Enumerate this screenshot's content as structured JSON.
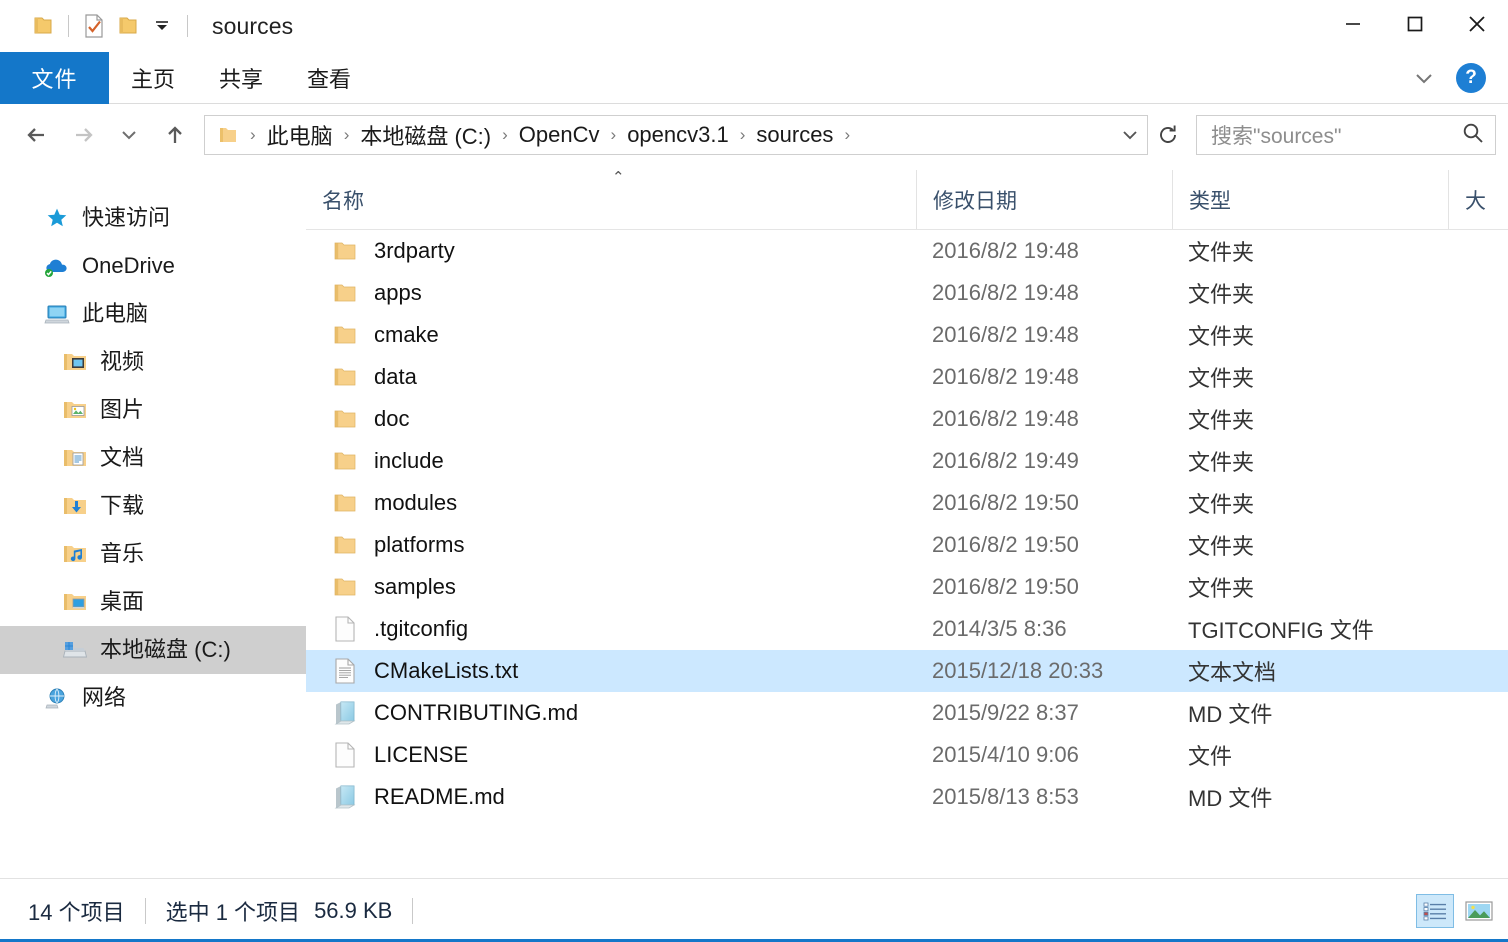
{
  "window": {
    "title": "sources",
    "quick_access": [
      {
        "name": "folder-icon",
        "label": "当前文件夹"
      },
      {
        "name": "properties-icon",
        "label": "属性"
      },
      {
        "name": "new-folder-icon",
        "label": "新建文件夹"
      },
      {
        "name": "customize-dropdown-icon",
        "label": "自定义快速访问工具栏"
      }
    ],
    "controls": {
      "minimize": "最小化",
      "maximize": "最大化",
      "close": "关闭"
    }
  },
  "ribbon": {
    "tabs": [
      {
        "label": "文件",
        "active": true
      },
      {
        "label": "主页",
        "active": false
      },
      {
        "label": "共享",
        "active": false
      },
      {
        "label": "查看",
        "active": false
      }
    ],
    "expand_label": "展开功能区",
    "help_label": "?"
  },
  "address": {
    "back_label": "后退",
    "forward_label": "前进",
    "recent_label": "最近浏览的位置",
    "up_label": "上移一级",
    "crumbs": [
      "此电脑",
      "本地磁盘 (C:)",
      "OpenCv",
      "opencv3.1",
      "sources"
    ],
    "separator": "›",
    "dropdown_label": "历史记录",
    "refresh_label": "刷新"
  },
  "search": {
    "placeholder": "搜索\"sources\"",
    "icon": "search-icon"
  },
  "sidebar": {
    "items": [
      {
        "label": "快速访问",
        "icon": "star-icon",
        "indent": false,
        "selected": false
      },
      {
        "label": "OneDrive",
        "icon": "cloud-icon",
        "indent": false,
        "selected": false
      },
      {
        "label": "此电脑",
        "icon": "computer-icon",
        "indent": false,
        "selected": false
      },
      {
        "label": "视频",
        "icon": "video-folder-icon",
        "indent": true,
        "selected": false
      },
      {
        "label": "图片",
        "icon": "pictures-folder-icon",
        "indent": true,
        "selected": false
      },
      {
        "label": "文档",
        "icon": "documents-folder-icon",
        "indent": true,
        "selected": false
      },
      {
        "label": "下载",
        "icon": "downloads-folder-icon",
        "indent": true,
        "selected": false
      },
      {
        "label": "音乐",
        "icon": "music-folder-icon",
        "indent": true,
        "selected": false
      },
      {
        "label": "桌面",
        "icon": "desktop-folder-icon",
        "indent": true,
        "selected": false
      },
      {
        "label": "本地磁盘 (C:)",
        "icon": "drive-icon",
        "indent": true,
        "selected": true
      },
      {
        "label": "网络",
        "icon": "network-icon",
        "indent": false,
        "selected": false
      }
    ]
  },
  "filelist": {
    "columns": [
      {
        "label": "名称",
        "key": "name"
      },
      {
        "label": "修改日期",
        "key": "date"
      },
      {
        "label": "类型",
        "key": "type"
      },
      {
        "label": "大",
        "key": "size"
      }
    ],
    "sort_indicator": "⌃",
    "rows": [
      {
        "name": "3rdparty",
        "date": "2016/8/2 19:48",
        "type": "文件夹",
        "icon": "folder-icon",
        "selected": false
      },
      {
        "name": "apps",
        "date": "2016/8/2 19:48",
        "type": "文件夹",
        "icon": "folder-icon",
        "selected": false
      },
      {
        "name": "cmake",
        "date": "2016/8/2 19:48",
        "type": "文件夹",
        "icon": "folder-icon",
        "selected": false
      },
      {
        "name": "data",
        "date": "2016/8/2 19:48",
        "type": "文件夹",
        "icon": "folder-icon",
        "selected": false
      },
      {
        "name": "doc",
        "date": "2016/8/2 19:48",
        "type": "文件夹",
        "icon": "folder-icon",
        "selected": false
      },
      {
        "name": "include",
        "date": "2016/8/2 19:49",
        "type": "文件夹",
        "icon": "folder-icon",
        "selected": false
      },
      {
        "name": "modules",
        "date": "2016/8/2 19:50",
        "type": "文件夹",
        "icon": "folder-icon",
        "selected": false
      },
      {
        "name": "platforms",
        "date": "2016/8/2 19:50",
        "type": "文件夹",
        "icon": "folder-icon",
        "selected": false
      },
      {
        "name": "samples",
        "date": "2016/8/2 19:50",
        "type": "文件夹",
        "icon": "folder-icon",
        "selected": false
      },
      {
        "name": ".tgitconfig",
        "date": "2014/3/5 8:36",
        "type": "TGITCONFIG 文件",
        "icon": "blank-file-icon",
        "selected": false
      },
      {
        "name": "CMakeLists.txt",
        "date": "2015/12/18 20:33",
        "type": "文本文档",
        "icon": "text-file-icon",
        "selected": true
      },
      {
        "name": "CONTRIBUTING.md",
        "date": "2015/9/22 8:37",
        "type": "MD 文件",
        "icon": "md-file-icon",
        "selected": false
      },
      {
        "name": "LICENSE",
        "date": "2015/4/10 9:06",
        "type": "文件",
        "icon": "blank-file-icon",
        "selected": false
      },
      {
        "name": "README.md",
        "date": "2015/8/13 8:53",
        "type": "MD 文件",
        "icon": "md-file-icon",
        "selected": false
      }
    ]
  },
  "scrollbar": {
    "left_arrow": "‹",
    "right_arrow": "›",
    "thumb_percent": 87
  },
  "status": {
    "item_count": "14 个项目",
    "selection": "选中 1 个项目",
    "selection_size": "56.9 KB",
    "views": [
      {
        "name": "details-view-button",
        "label": "详细信息",
        "active": true
      },
      {
        "name": "large-icons-view-button",
        "label": "大图标",
        "active": false
      }
    ]
  },
  "colors": {
    "accent": "#1477c9",
    "selection": "#cce8ff",
    "sidebar_selection": "#cfcfcf",
    "header_text": "#39506b"
  }
}
